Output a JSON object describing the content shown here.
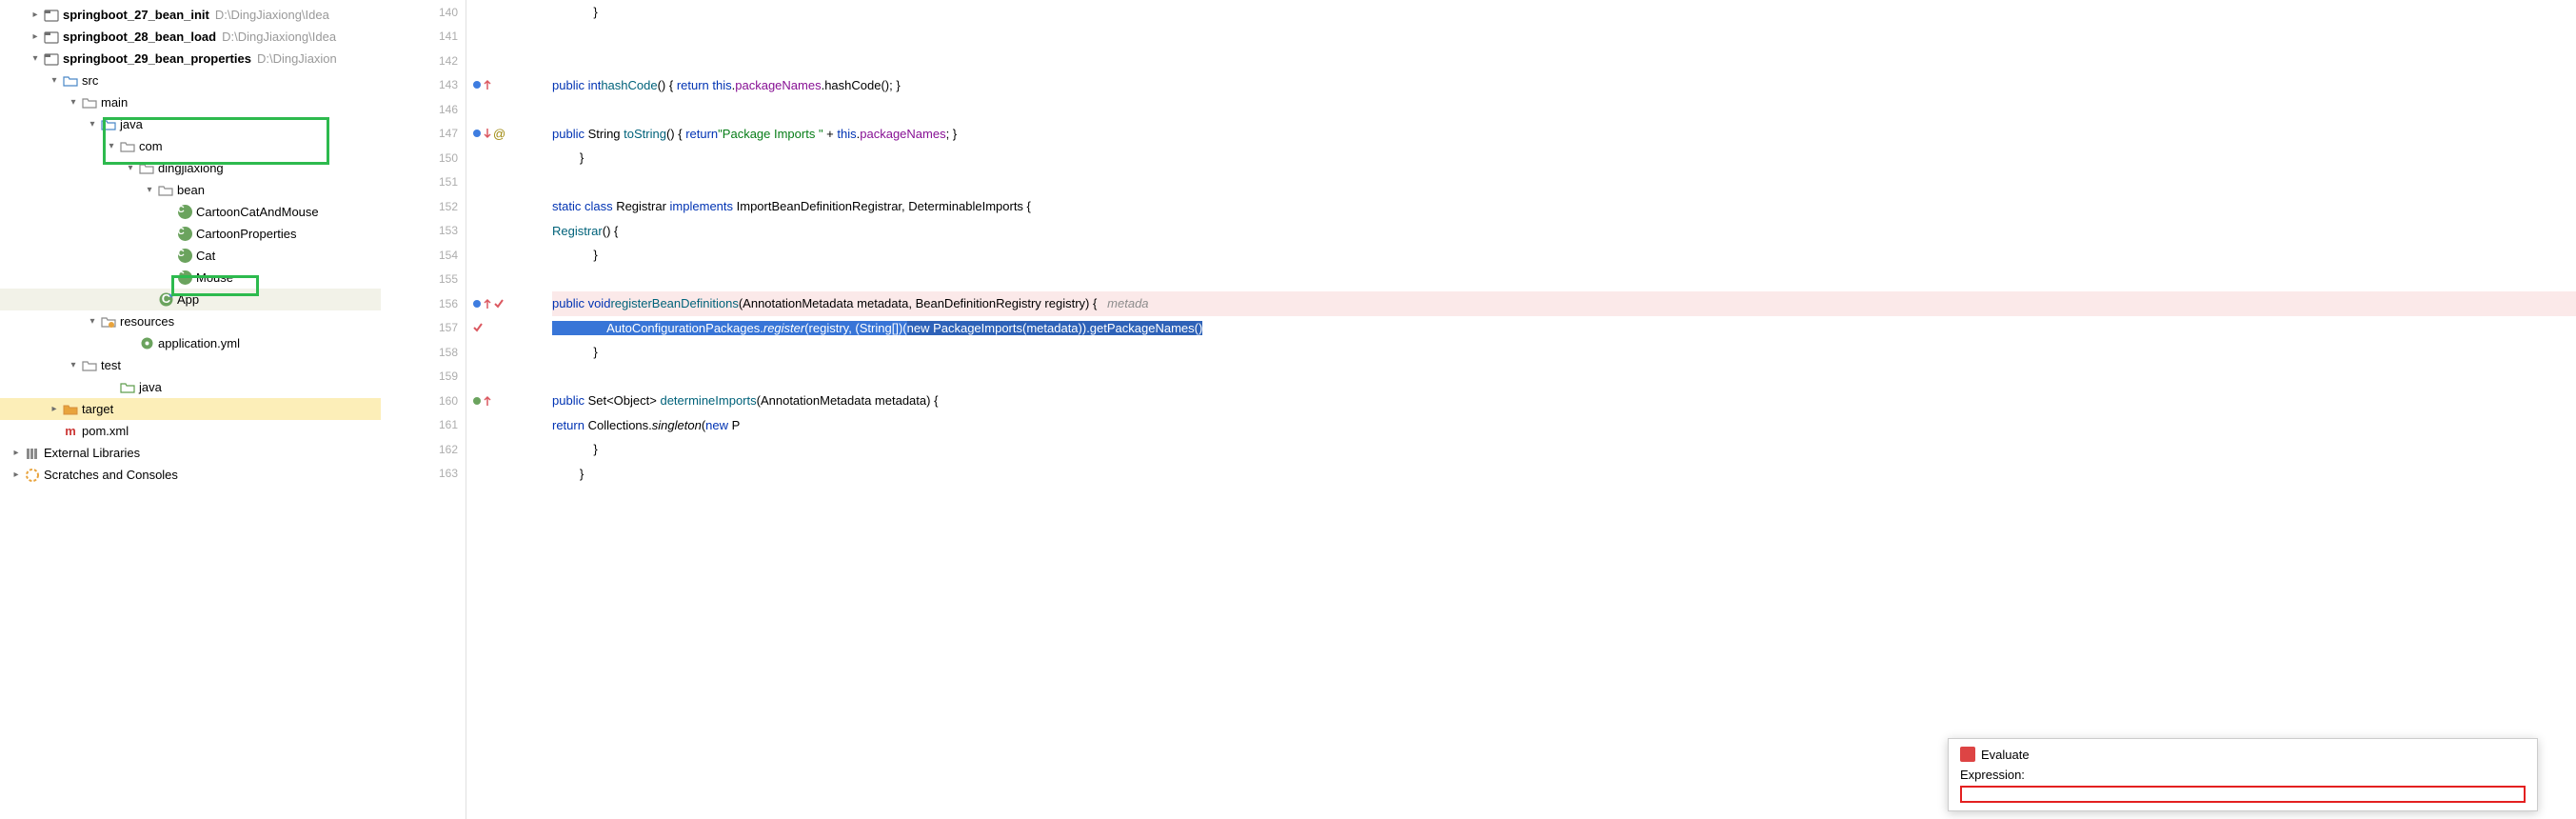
{
  "tree": {
    "items": [
      {
        "indent": 1,
        "arrow": ">",
        "icon": "module",
        "label": "springboot_27_bean_init",
        "bold": true,
        "path": "D:\\DingJiaxiong\\Idea"
      },
      {
        "indent": 1,
        "arrow": ">",
        "icon": "module",
        "label": "springboot_28_bean_load",
        "bold": true,
        "path": "D:\\DingJiaxiong\\Idea"
      },
      {
        "indent": 1,
        "arrow": "v",
        "icon": "module",
        "label": "springboot_29_bean_properties",
        "bold": true,
        "path": "D:\\DingJiaxion"
      },
      {
        "indent": 2,
        "arrow": "v",
        "icon": "folder-blue",
        "label": "src"
      },
      {
        "indent": 3,
        "arrow": "v",
        "icon": "folder",
        "label": "main"
      },
      {
        "indent": 4,
        "arrow": "v",
        "icon": "folder-blue",
        "label": "java"
      },
      {
        "indent": 5,
        "arrow": "v",
        "icon": "folder",
        "label": "com"
      },
      {
        "indent": 6,
        "arrow": "v",
        "icon": "folder",
        "label": "dingjiaxiong"
      },
      {
        "indent": 7,
        "arrow": "v",
        "icon": "folder",
        "label": "bean"
      },
      {
        "indent": 8,
        "arrow": "",
        "icon": "class",
        "label": "CartoonCatAndMouse"
      },
      {
        "indent": 8,
        "arrow": "",
        "icon": "class",
        "label": "CartoonProperties"
      },
      {
        "indent": 8,
        "arrow": "",
        "icon": "class",
        "label": "Cat"
      },
      {
        "indent": 8,
        "arrow": "",
        "icon": "class",
        "label": "Mouse"
      },
      {
        "indent": 7,
        "arrow": "",
        "icon": "java",
        "label": "App",
        "highlighted": true
      },
      {
        "indent": 4,
        "arrow": "v",
        "icon": "folder-res",
        "label": "resources"
      },
      {
        "indent": 6,
        "arrow": "",
        "icon": "yml",
        "label": "application.yml"
      },
      {
        "indent": 3,
        "arrow": "v",
        "icon": "folder",
        "label": "test"
      },
      {
        "indent": 5,
        "arrow": "",
        "icon": "folder-test",
        "label": "java"
      },
      {
        "indent": 2,
        "arrow": ">",
        "icon": "folder-orange",
        "label": "target",
        "selected": true
      },
      {
        "indent": 2,
        "arrow": "",
        "icon": "maven",
        "label": "pom.xml"
      },
      {
        "indent": 0,
        "arrow": ">",
        "icon": "lib",
        "label": "External Libraries"
      },
      {
        "indent": 0,
        "arrow": ">",
        "icon": "scratch",
        "label": "Scratches and Consoles"
      }
    ]
  },
  "gutter": {
    "lines": [
      140,
      141,
      142,
      143,
      146,
      147,
      150,
      151,
      152,
      153,
      154,
      155,
      156,
      157,
      158,
      159,
      160,
      161,
      162,
      163
    ],
    "markers": {
      "143": {
        "dot": "blue",
        "arrow": "up-red"
      },
      "147": {
        "dot": "blue",
        "arrow": "down-red",
        "at": "@"
      },
      "156": {
        "dot": "blue",
        "arrow": "up-red",
        "check": "red"
      },
      "157": {
        "check": "red"
      },
      "160": {
        "dot": "green",
        "arrow": "up-red"
      }
    }
  },
  "code": [
    {
      "n": 140,
      "txt": "            }"
    },
    {
      "n": 141,
      "txt": ""
    },
    {
      "n": 142,
      "txt": ""
    },
    {
      "n": 143,
      "txt": "            public int hashCode() { return this.packageNames.hashCode(); }"
    },
    {
      "n": 146,
      "txt": ""
    },
    {
      "n": 147,
      "txt": "            public String toString() { return \"Package Imports \" + this.packageNames; }"
    },
    {
      "n": 150,
      "txt": "        }"
    },
    {
      "n": 151,
      "txt": ""
    },
    {
      "n": 152,
      "txt": "        static class Registrar implements ImportBeanDefinitionRegistrar, DeterminableImports {"
    },
    {
      "n": 153,
      "txt": "            Registrar() {"
    },
    {
      "n": 154,
      "txt": "            }"
    },
    {
      "n": 155,
      "txt": ""
    },
    {
      "n": 156,
      "exec": true,
      "txt": "            public void registerBeanDefinitions(AnnotationMetadata metadata, BeanDefinitionRegistry registry) {   metada"
    },
    {
      "n": 157,
      "txt": "                AutoConfigurationPackages.register(registry, (String[])(new PackageImports(metadata)).getPackageNames()"
    },
    {
      "n": 158,
      "txt": "            }"
    },
    {
      "n": 159,
      "txt": ""
    },
    {
      "n": 160,
      "txt": "            public Set<Object> determineImports(AnnotationMetadata metadata) {"
    },
    {
      "n": 161,
      "txt": "                return Collections.singleton(new P"
    },
    {
      "n": 162,
      "txt": "            }"
    },
    {
      "n": 163,
      "txt": "        }"
    }
  ],
  "evaluate": {
    "title": "Evaluate",
    "expression_label": "Expression:"
  }
}
